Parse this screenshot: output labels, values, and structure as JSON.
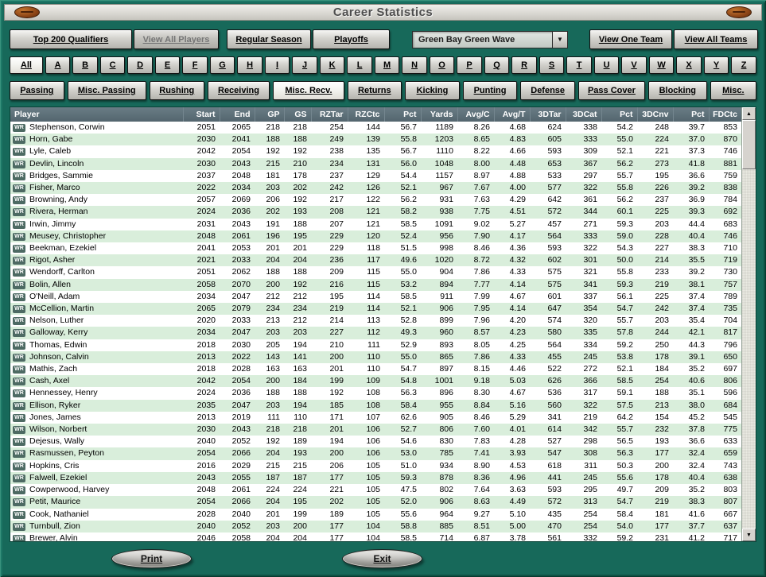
{
  "window": {
    "title": "Career Statistics"
  },
  "toolbar": {
    "top200": "Top 200 Qualifiers",
    "view_all_players": "View All Players",
    "regular_season": "Regular Season",
    "playoffs": "Playoffs",
    "team_selected": "Green Bay Green Wave",
    "view_one_team": "View One Team",
    "view_all_teams": "View All Teams"
  },
  "alphabet": [
    "All",
    "A",
    "B",
    "C",
    "D",
    "E",
    "F",
    "G",
    "H",
    "I",
    "J",
    "K",
    "L",
    "M",
    "N",
    "O",
    "P",
    "Q",
    "R",
    "S",
    "T",
    "U",
    "V",
    "W",
    "X",
    "Y",
    "Z"
  ],
  "alphabet_selected": "All",
  "tabs": [
    "Passing",
    "Misc. Passing",
    "Rushing",
    "Receiving",
    "Misc. Recv.",
    "Returns",
    "Kicking",
    "Punting",
    "Defense",
    "Pass Cover",
    "Blocking",
    "Misc."
  ],
  "selected_tab": "Misc. Recv.",
  "icons": {
    "dropdown_arrow": "▼",
    "scroll_up": "▲",
    "scroll_down": "▼"
  },
  "footer": {
    "print_label": "Print",
    "exit_label": "Exit"
  },
  "colors": {
    "background": "#17695a",
    "table_header": "#5d7078",
    "row_alt": "#d9eedb",
    "titlebar": "#d9d7d0",
    "football": "#8a4316"
  },
  "table": {
    "columns": [
      "Player",
      "Start",
      "End",
      "GP",
      "GS",
      "RZTar",
      "RZCtc",
      "Pct",
      "Yards",
      "Avg/C",
      "Avg/T",
      "3DTar",
      "3DCat",
      "Pct",
      "3DCnv",
      "Pct",
      "FDCtc"
    ],
    "rows": [
      {
        "pos": "WR",
        "name": "Stephenson, Corwin",
        "values": [
          "2051",
          "2065",
          "218",
          "218",
          "254",
          "144",
          "56.7",
          "1189",
          "8.26",
          "4.68",
          "624",
          "338",
          "54.2",
          "248",
          "39.7",
          "853"
        ]
      },
      {
        "pos": "WR",
        "name": "Horn, Gabe",
        "values": [
          "2030",
          "2041",
          "188",
          "188",
          "249",
          "139",
          "55.8",
          "1203",
          "8.65",
          "4.83",
          "605",
          "333",
          "55.0",
          "224",
          "37.0",
          "870"
        ]
      },
      {
        "pos": "WR",
        "name": "Lyle, Caleb",
        "values": [
          "2042",
          "2054",
          "192",
          "192",
          "238",
          "135",
          "56.7",
          "1110",
          "8.22",
          "4.66",
          "593",
          "309",
          "52.1",
          "221",
          "37.3",
          "746"
        ]
      },
      {
        "pos": "WR",
        "name": "Devlin, Lincoln",
        "values": [
          "2030",
          "2043",
          "215",
          "210",
          "234",
          "131",
          "56.0",
          "1048",
          "8.00",
          "4.48",
          "653",
          "367",
          "56.2",
          "273",
          "41.8",
          "881"
        ]
      },
      {
        "pos": "WR",
        "name": "Bridges, Sammie",
        "values": [
          "2037",
          "2048",
          "181",
          "178",
          "237",
          "129",
          "54.4",
          "1157",
          "8.97",
          "4.88",
          "533",
          "297",
          "55.7",
          "195",
          "36.6",
          "759"
        ]
      },
      {
        "pos": "WR",
        "name": "Fisher, Marco",
        "values": [
          "2022",
          "2034",
          "203",
          "202",
          "242",
          "126",
          "52.1",
          "967",
          "7.67",
          "4.00",
          "577",
          "322",
          "55.8",
          "226",
          "39.2",
          "838"
        ]
      },
      {
        "pos": "WR",
        "name": "Browning, Andy",
        "values": [
          "2057",
          "2069",
          "206",
          "192",
          "217",
          "122",
          "56.2",
          "931",
          "7.63",
          "4.29",
          "642",
          "361",
          "56.2",
          "237",
          "36.9",
          "784"
        ]
      },
      {
        "pos": "WR",
        "name": "Rivera, Herman",
        "values": [
          "2024",
          "2036",
          "202",
          "193",
          "208",
          "121",
          "58.2",
          "938",
          "7.75",
          "4.51",
          "572",
          "344",
          "60.1",
          "225",
          "39.3",
          "692"
        ]
      },
      {
        "pos": "WR",
        "name": "Irwin, Jimmy",
        "values": [
          "2031",
          "2043",
          "191",
          "188",
          "207",
          "121",
          "58.5",
          "1091",
          "9.02",
          "5.27",
          "457",
          "271",
          "59.3",
          "203",
          "44.4",
          "683"
        ]
      },
      {
        "pos": "WR",
        "name": "Meusey, Christopher",
        "values": [
          "2048",
          "2061",
          "196",
          "195",
          "229",
          "120",
          "52.4",
          "956",
          "7.90",
          "4.17",
          "564",
          "333",
          "59.0",
          "228",
          "40.4",
          "746"
        ]
      },
      {
        "pos": "WR",
        "name": "Beekman, Ezekiel",
        "values": [
          "2041",
          "2053",
          "201",
          "201",
          "229",
          "118",
          "51.5",
          "998",
          "8.46",
          "4.36",
          "593",
          "322",
          "54.3",
          "227",
          "38.3",
          "710"
        ]
      },
      {
        "pos": "WR",
        "name": "Rigot, Asher",
        "values": [
          "2021",
          "2033",
          "204",
          "204",
          "236",
          "117",
          "49.6",
          "1020",
          "8.72",
          "4.32",
          "602",
          "301",
          "50.0",
          "214",
          "35.5",
          "719"
        ]
      },
      {
        "pos": "WR",
        "name": "Wendorff, Carlton",
        "values": [
          "2051",
          "2062",
          "188",
          "188",
          "209",
          "115",
          "55.0",
          "904",
          "7.86",
          "4.33",
          "575",
          "321",
          "55.8",
          "233",
          "39.2",
          "730"
        ]
      },
      {
        "pos": "WR",
        "name": "Bolin, Allen",
        "values": [
          "2058",
          "2070",
          "200",
          "192",
          "216",
          "115",
          "53.2",
          "894",
          "7.77",
          "4.14",
          "575",
          "341",
          "59.3",
          "219",
          "38.1",
          "757"
        ]
      },
      {
        "pos": "WR",
        "name": "O'Neill, Adam",
        "values": [
          "2034",
          "2047",
          "212",
          "212",
          "195",
          "114",
          "58.5",
          "911",
          "7.99",
          "4.67",
          "601",
          "337",
          "56.1",
          "225",
          "37.4",
          "789"
        ]
      },
      {
        "pos": "WR",
        "name": "McCellion, Martin",
        "values": [
          "2065",
          "2079",
          "234",
          "234",
          "219",
          "114",
          "52.1",
          "906",
          "7.95",
          "4.14",
          "647",
          "354",
          "54.7",
          "242",
          "37.4",
          "735"
        ]
      },
      {
        "pos": "WR",
        "name": "Nelson, Luther",
        "values": [
          "2020",
          "2033",
          "213",
          "212",
          "214",
          "113",
          "52.8",
          "899",
          "7.96",
          "4.20",
          "574",
          "320",
          "55.7",
          "203",
          "35.4",
          "704"
        ]
      },
      {
        "pos": "WR",
        "name": "Galloway, Kerry",
        "values": [
          "2034",
          "2047",
          "203",
          "203",
          "227",
          "112",
          "49.3",
          "960",
          "8.57",
          "4.23",
          "580",
          "335",
          "57.8",
          "244",
          "42.1",
          "817"
        ]
      },
      {
        "pos": "WR",
        "name": "Thomas, Edwin",
        "values": [
          "2018",
          "2030",
          "205",
          "194",
          "210",
          "111",
          "52.9",
          "893",
          "8.05",
          "4.25",
          "564",
          "334",
          "59.2",
          "250",
          "44.3",
          "796"
        ]
      },
      {
        "pos": "WR",
        "name": "Johnson, Calvin",
        "values": [
          "2013",
          "2022",
          "143",
          "141",
          "200",
          "110",
          "55.0",
          "865",
          "7.86",
          "4.33",
          "455",
          "245",
          "53.8",
          "178",
          "39.1",
          "650"
        ]
      },
      {
        "pos": "WR",
        "name": "Mathis, Zach",
        "values": [
          "2018",
          "2028",
          "163",
          "163",
          "201",
          "110",
          "54.7",
          "897",
          "8.15",
          "4.46",
          "522",
          "272",
          "52.1",
          "184",
          "35.2",
          "697"
        ]
      },
      {
        "pos": "WR",
        "name": "Cash, Axel",
        "values": [
          "2042",
          "2054",
          "200",
          "184",
          "199",
          "109",
          "54.8",
          "1001",
          "9.18",
          "5.03",
          "626",
          "366",
          "58.5",
          "254",
          "40.6",
          "806"
        ]
      },
      {
        "pos": "WR",
        "name": "Hennessey, Henry",
        "values": [
          "2024",
          "2036",
          "188",
          "188",
          "192",
          "108",
          "56.3",
          "896",
          "8.30",
          "4.67",
          "536",
          "317",
          "59.1",
          "188",
          "35.1",
          "596"
        ]
      },
      {
        "pos": "WR",
        "name": "Ellison, Ryker",
        "values": [
          "2035",
          "2047",
          "203",
          "194",
          "185",
          "108",
          "58.4",
          "955",
          "8.84",
          "5.16",
          "560",
          "322",
          "57.5",
          "213",
          "38.0",
          "684"
        ]
      },
      {
        "pos": "WR",
        "name": "Jones, James",
        "values": [
          "2013",
          "2019",
          "111",
          "110",
          "171",
          "107",
          "62.6",
          "905",
          "8.46",
          "5.29",
          "341",
          "219",
          "64.2",
          "154",
          "45.2",
          "545"
        ]
      },
      {
        "pos": "WR",
        "name": "Wilson, Norbert",
        "values": [
          "2030",
          "2043",
          "218",
          "218",
          "201",
          "106",
          "52.7",
          "806",
          "7.60",
          "4.01",
          "614",
          "342",
          "55.7",
          "232",
          "37.8",
          "775"
        ]
      },
      {
        "pos": "WR",
        "name": "Dejesus, Wally",
        "values": [
          "2040",
          "2052",
          "192",
          "189",
          "194",
          "106",
          "54.6",
          "830",
          "7.83",
          "4.28",
          "527",
          "298",
          "56.5",
          "193",
          "36.6",
          "633"
        ]
      },
      {
        "pos": "WR",
        "name": "Rasmussen, Peyton",
        "values": [
          "2054",
          "2066",
          "204",
          "193",
          "200",
          "106",
          "53.0",
          "785",
          "7.41",
          "3.93",
          "547",
          "308",
          "56.3",
          "177",
          "32.4",
          "659"
        ]
      },
      {
        "pos": "WR",
        "name": "Hopkins, Cris",
        "values": [
          "2016",
          "2029",
          "215",
          "215",
          "206",
          "105",
          "51.0",
          "934",
          "8.90",
          "4.53",
          "618",
          "311",
          "50.3",
          "200",
          "32.4",
          "743"
        ]
      },
      {
        "pos": "WR",
        "name": "Falwell, Ezekiel",
        "values": [
          "2043",
          "2055",
          "187",
          "187",
          "177",
          "105",
          "59.3",
          "878",
          "8.36",
          "4.96",
          "441",
          "245",
          "55.6",
          "178",
          "40.4",
          "638"
        ]
      },
      {
        "pos": "WR",
        "name": "Cowperwood, Harvey",
        "values": [
          "2048",
          "2061",
          "224",
          "224",
          "221",
          "105",
          "47.5",
          "802",
          "7.64",
          "3.63",
          "593",
          "295",
          "49.7",
          "209",
          "35.2",
          "803"
        ]
      },
      {
        "pos": "WR",
        "name": "Petit, Maurice",
        "values": [
          "2054",
          "2066",
          "204",
          "195",
          "202",
          "105",
          "52.0",
          "906",
          "8.63",
          "4.49",
          "572",
          "313",
          "54.7",
          "219",
          "38.3",
          "807"
        ]
      },
      {
        "pos": "WR",
        "name": "Cook, Nathaniel",
        "values": [
          "2028",
          "2040",
          "201",
          "199",
          "189",
          "105",
          "55.6",
          "964",
          "9.27",
          "5.10",
          "435",
          "254",
          "58.4",
          "181",
          "41.6",
          "667"
        ]
      },
      {
        "pos": "WR",
        "name": "Turnbull, Zion",
        "values": [
          "2040",
          "2052",
          "203",
          "200",
          "177",
          "104",
          "58.8",
          "885",
          "8.51",
          "5.00",
          "470",
          "254",
          "54.0",
          "177",
          "37.7",
          "637"
        ]
      },
      {
        "pos": "WR",
        "name": "Brewer, Alvin",
        "values": [
          "2046",
          "2058",
          "204",
          "204",
          "177",
          "104",
          "58.5",
          "714",
          "6.87",
          "3.78",
          "561",
          "332",
          "59.2",
          "231",
          "41.2",
          "717"
        ]
      }
    ]
  }
}
